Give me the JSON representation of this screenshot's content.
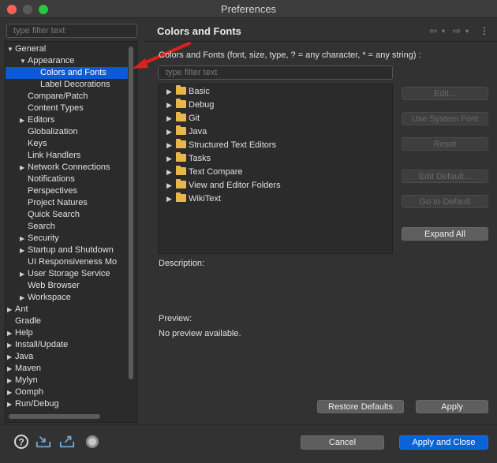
{
  "window": {
    "title": "Preferences"
  },
  "left": {
    "filter_placeholder": "type filter text",
    "tree": [
      {
        "label": "General",
        "indent": 0,
        "twisty": "open"
      },
      {
        "label": "Appearance",
        "indent": 1,
        "twisty": "open"
      },
      {
        "label": "Colors and Fonts",
        "indent": 2,
        "twisty": "",
        "selected": true
      },
      {
        "label": "Label Decorations",
        "indent": 2,
        "twisty": ""
      },
      {
        "label": "Compare/Patch",
        "indent": 1,
        "twisty": ""
      },
      {
        "label": "Content Types",
        "indent": 1,
        "twisty": ""
      },
      {
        "label": "Editors",
        "indent": 1,
        "twisty": "closed"
      },
      {
        "label": "Globalization",
        "indent": 1,
        "twisty": ""
      },
      {
        "label": "Keys",
        "indent": 1,
        "twisty": ""
      },
      {
        "label": "Link Handlers",
        "indent": 1,
        "twisty": ""
      },
      {
        "label": "Network Connections",
        "indent": 1,
        "twisty": "closed"
      },
      {
        "label": "Notifications",
        "indent": 1,
        "twisty": ""
      },
      {
        "label": "Perspectives",
        "indent": 1,
        "twisty": ""
      },
      {
        "label": "Project Natures",
        "indent": 1,
        "twisty": ""
      },
      {
        "label": "Quick Search",
        "indent": 1,
        "twisty": ""
      },
      {
        "label": "Search",
        "indent": 1,
        "twisty": ""
      },
      {
        "label": "Security",
        "indent": 1,
        "twisty": "closed"
      },
      {
        "label": "Startup and Shutdown",
        "indent": 1,
        "twisty": "closed"
      },
      {
        "label": "UI Responsiveness Mo",
        "indent": 1,
        "twisty": ""
      },
      {
        "label": "User Storage Service",
        "indent": 1,
        "twisty": "closed"
      },
      {
        "label": "Web Browser",
        "indent": 1,
        "twisty": ""
      },
      {
        "label": "Workspace",
        "indent": 1,
        "twisty": "closed"
      },
      {
        "label": "Ant",
        "indent": 0,
        "twisty": "closed"
      },
      {
        "label": "Gradle",
        "indent": 0,
        "twisty": ""
      },
      {
        "label": "Help",
        "indent": 0,
        "twisty": "closed"
      },
      {
        "label": "Install/Update",
        "indent": 0,
        "twisty": "closed"
      },
      {
        "label": "Java",
        "indent": 0,
        "twisty": "closed"
      },
      {
        "label": "Maven",
        "indent": 0,
        "twisty": "closed"
      },
      {
        "label": "Mylyn",
        "indent": 0,
        "twisty": "closed"
      },
      {
        "label": "Oomph",
        "indent": 0,
        "twisty": "closed"
      },
      {
        "label": "Run/Debug",
        "indent": 0,
        "twisty": "closed"
      }
    ]
  },
  "right": {
    "title": "Colors and Fonts",
    "description_line": "Colors and Fonts (font, size, type, ? = any character, * = any string) :",
    "filter_placeholder": "type filter text",
    "categories": [
      "Basic",
      "Debug",
      "Git",
      "Java",
      "Structured Text Editors",
      "Tasks",
      "Text Compare",
      "View and Editor Folders",
      "WikiText"
    ],
    "buttons": {
      "edit": "Edit...",
      "use_system_font": "Use System Font",
      "reset": "Reset",
      "edit_default": "Edit Default...",
      "go_to_default": "Go to Default",
      "expand_all": "Expand All"
    },
    "description_label": "Description:",
    "preview_label": "Preview:",
    "preview_text": "No preview available.",
    "restore_defaults": "Restore Defaults",
    "apply": "Apply"
  },
  "footer": {
    "cancel": "Cancel",
    "apply_and_close": "Apply and Close"
  },
  "colors": {
    "selection": "#0a5bd5",
    "primary_button": "#0a64d8",
    "annotation_arrow": "#e0201c"
  }
}
